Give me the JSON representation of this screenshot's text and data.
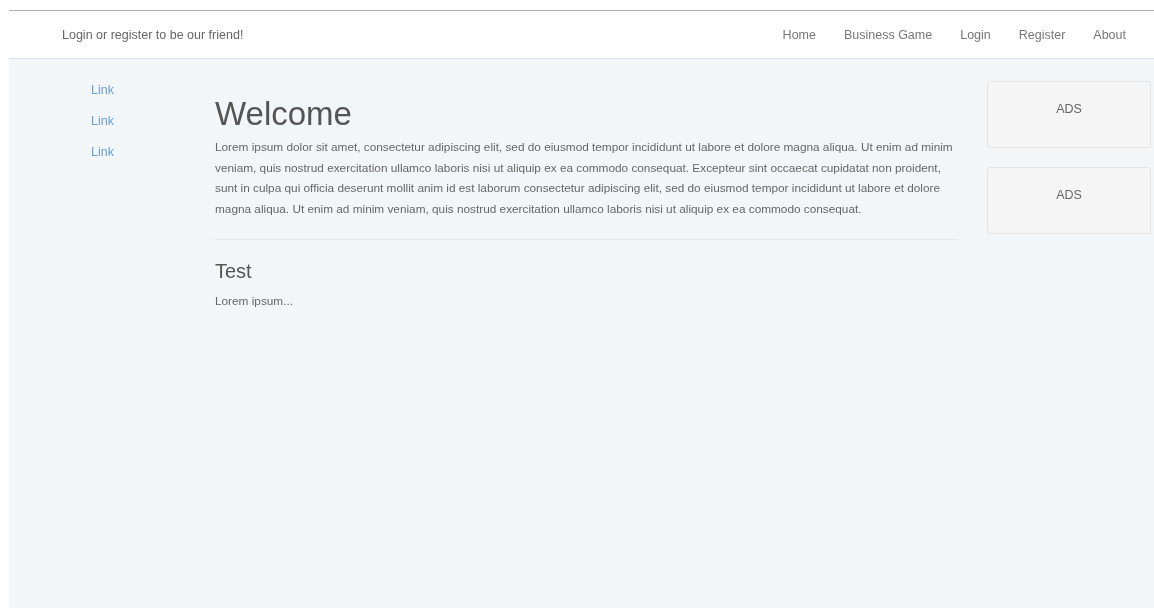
{
  "navbar": {
    "tagline": "Login or register to be our friend!",
    "links": [
      "Home",
      "Business Game",
      "Login",
      "Register",
      "About"
    ]
  },
  "sidebar": {
    "links": [
      "Link",
      "Link",
      "Link"
    ]
  },
  "main": {
    "title": "Welcome",
    "intro": "Lorem ipsum dolor sit amet, consectetur adipiscing elit, sed do eiusmod tempor incididunt ut labore et dolore magna aliqua. Ut enim ad minim veniam, quis nostrud exercitation ullamco laboris nisi ut aliquip ex ea commodo consequat. Excepteur sint occaecat cupidatat non proident, sunt in culpa qui officia deserunt mollit anim id est laborum consectetur adipiscing elit, sed do eiusmod tempor incididunt ut labore et dolore magna aliqua. Ut enim ad minim veniam, quis nostrud exercitation ullamco laboris nisi ut aliquip ex ea commodo consequat.",
    "sections": [
      {
        "title": "Test",
        "text": "Lorem ipsum..."
      }
    ]
  },
  "ads": [
    "ADS",
    "ADS"
  ]
}
